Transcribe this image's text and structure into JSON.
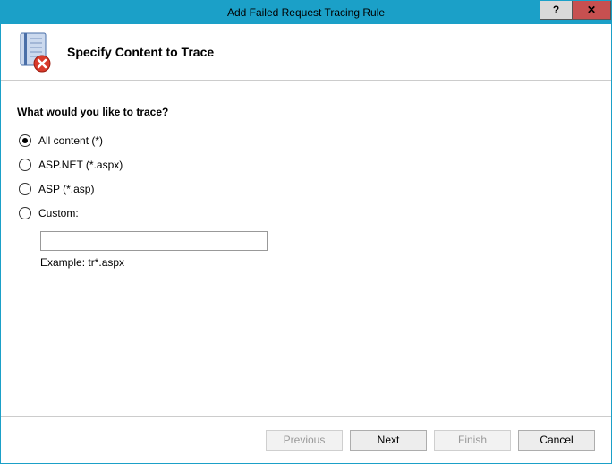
{
  "window": {
    "title": "Add Failed Request Tracing Rule"
  },
  "header": {
    "title": "Specify Content to Trace"
  },
  "content": {
    "prompt": "What would you like to trace?",
    "options": [
      {
        "label": "All content (*)",
        "selected": true
      },
      {
        "label": "ASP.NET (*.aspx)",
        "selected": false
      },
      {
        "label": "ASP (*.asp)",
        "selected": false
      },
      {
        "label": "Custom:",
        "selected": false
      }
    ],
    "custom_value": "",
    "example": "Example: tr*.aspx"
  },
  "footer": {
    "previous": "Previous",
    "next": "Next",
    "finish": "Finish",
    "cancel": "Cancel"
  }
}
